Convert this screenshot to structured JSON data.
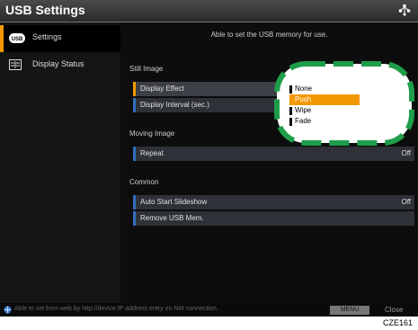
{
  "window": {
    "title": "USB Settings"
  },
  "sidebar": {
    "items": [
      {
        "label": "Settings",
        "icon": "usb-icon"
      },
      {
        "label": "Display Status",
        "icon": "display-status-icon"
      }
    ]
  },
  "main": {
    "info": "Able to set the USB memory for use.",
    "sections": [
      {
        "title": "Still Image",
        "rows": [
          {
            "label": "Display Effect",
            "value": ""
          },
          {
            "label": "Display Interval (sec.)",
            "value": ""
          }
        ]
      },
      {
        "title": "Moving Image",
        "rows": [
          {
            "label": "Repeat",
            "value": "Off"
          }
        ]
      },
      {
        "title": "Common",
        "rows": [
          {
            "label": "Auto Start Slideshow",
            "value": "Off"
          },
          {
            "label": "Remove USB Mem.",
            "value": ""
          }
        ]
      }
    ]
  },
  "dropdown": {
    "options": [
      "None",
      "Push",
      "Wipe",
      "Fade"
    ],
    "selected": "Push"
  },
  "footer": {
    "text": "Able to set from web by http://device IP address entry on NW connection.",
    "menu_label": "MENU",
    "close_label": "Close"
  },
  "figure_code": "CZE161",
  "colors": {
    "accent": "#f39800",
    "row_marker": "#2e6fbf",
    "highlight_ring": "#1e9e4a"
  }
}
